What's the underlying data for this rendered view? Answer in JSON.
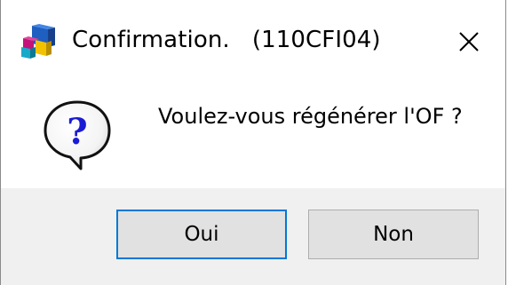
{
  "window": {
    "title": "Confirmation.   (110CFI04)",
    "app_icon": "stacked-blocks-icon",
    "close_icon": "close-icon"
  },
  "dialog": {
    "icon": "question-icon",
    "message": "Voulez-vous régénérer l'OF ?"
  },
  "buttons": {
    "yes_label": "Oui",
    "no_label": "Non",
    "default": "yes"
  },
  "colors": {
    "focus_border": "#0078d7",
    "button_face": "#e1e1e1",
    "footer_bg": "#f0f0f0",
    "question_mark": "#1b1bd6"
  }
}
